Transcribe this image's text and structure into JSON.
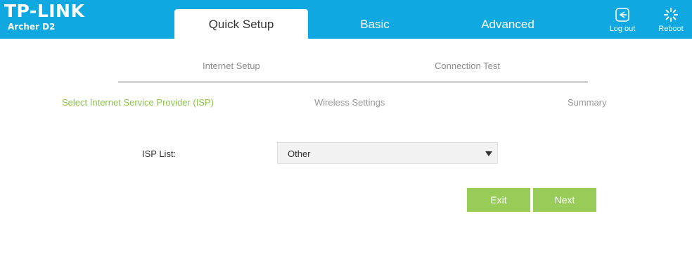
{
  "brand": {
    "logo": "TP-LINK",
    "model": "Archer D2"
  },
  "tabs": [
    {
      "label": "Quick Setup",
      "active": true
    },
    {
      "label": "Basic",
      "active": false
    },
    {
      "label": "Advanced",
      "active": false
    }
  ],
  "actions": {
    "logout_label": "Log out",
    "reboot_label": "Reboot"
  },
  "steps": {
    "main": [
      "Internet Setup",
      "Connection Test"
    ],
    "sub": [
      "Select Internet Service Provider (ISP)",
      "Wireless Settings",
      "Summary"
    ],
    "active_sub": "Select Internet Service Provider (ISP)"
  },
  "form": {
    "isp_label": "ISP List:",
    "isp_value": "Other"
  },
  "buttons": {
    "exit": "Exit",
    "next": "Next"
  },
  "colors": {
    "header": "#10a8e0",
    "accent": "#96cc57",
    "active_step": "#8bc34a"
  }
}
